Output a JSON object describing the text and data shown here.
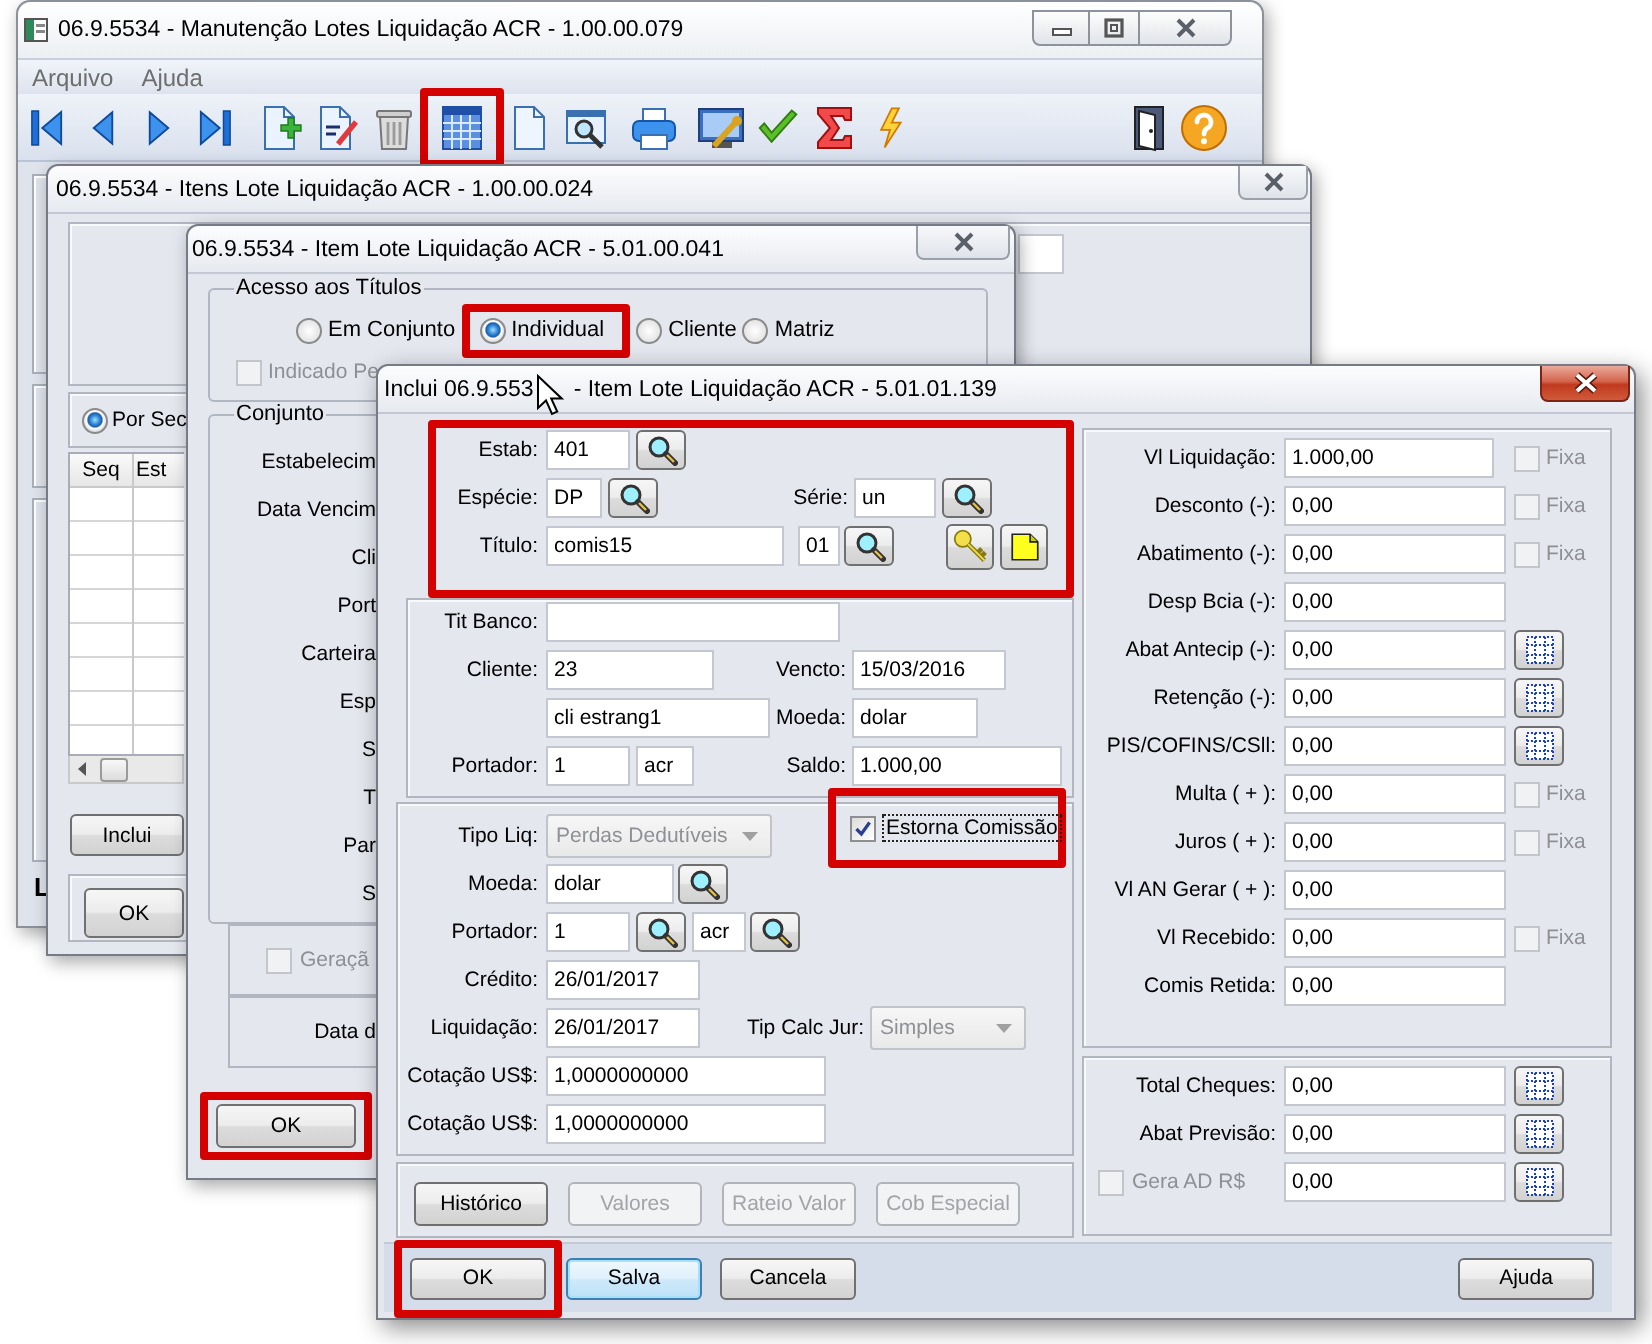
{
  "main_window": {
    "title": "06.9.5534 - Manutenção Lotes Liquidação ACR - 1.00.00.079",
    "menu": [
      {
        "label": "Arquivo",
        "disabled": true
      },
      {
        "label": "Ajuda",
        "disabled": true
      }
    ],
    "toolbar_groups": [
      {
        "items": [
          {
            "kind": "first",
            "highlighted": false
          },
          {
            "kind": "previous",
            "highlighted": false
          },
          {
            "kind": "next",
            "highlighted": false
          },
          {
            "kind": "last",
            "highlighted": false
          }
        ]
      },
      {
        "items": [
          {
            "kind": "new",
            "highlighted": false
          },
          {
            "kind": "edit",
            "highlighted": false
          },
          {
            "kind": "delete",
            "highlighted": false
          }
        ]
      },
      {
        "items": [
          {
            "kind": "calendar",
            "highlighted": true
          }
        ]
      },
      {
        "items": [
          {
            "kind": "document",
            "highlighted": false
          },
          {
            "kind": "preview",
            "highlighted": false
          }
        ]
      },
      {
        "items": [
          {
            "kind": "print",
            "highlighted": false
          }
        ]
      },
      {
        "items": [
          {
            "kind": "setup",
            "highlighted": false
          },
          {
            "kind": "confirm",
            "highlighted": false
          },
          {
            "kind": "sum",
            "highlighted": false
          },
          {
            "kind": "run",
            "highlighted": false
          }
        ]
      },
      {
        "items": [
          {
            "kind": "exit",
            "highlighted": false
          },
          {
            "kind": "help",
            "highlighted": false
          }
        ]
      }
    ],
    "status_text": "L"
  },
  "items_window": {
    "title": "06.9.5534 - Itens Lote Liquidação ACR - 1.00.00.024",
    "order_option": {
      "label": "Por Sec",
      "selected": true
    },
    "grid_columns": [
      "Seq",
      "Est"
    ],
    "add_button": {
      "label": "Inclui"
    },
    "ok_button": {
      "label": "OK"
    }
  },
  "item_window": {
    "title": "06.9.5534 - Item Lote Liquidação ACR - 5.01.00.041",
    "access": {
      "legend": "Acesso aos Títulos",
      "options": [
        {
          "label": "Em Conjunto",
          "selected": false,
          "highlighted": false
        },
        {
          "label": "Individual",
          "selected": true,
          "highlighted": true
        },
        {
          "label": "Cliente",
          "selected": false,
          "highlighted": false
        },
        {
          "label": "Matriz",
          "selected": false,
          "highlighted": false
        }
      ],
      "indicated": {
        "label": "Indicado Pe",
        "checked": false,
        "disabled": true
      }
    },
    "set_group": {
      "legend": "Conjunto",
      "labels": [
        "Estabelecim",
        "Data Vencim",
        "Cli",
        "Port",
        "Carteira",
        "Esp",
        "S",
        "T",
        "Par",
        "S"
      ]
    },
    "generation": {
      "label": "Geraçã",
      "checked": false,
      "disabled": true
    },
    "date_label": "Data d",
    "ok_button": {
      "label": "OK",
      "highlighted": true
    }
  },
  "include_dialog": {
    "title_parts": [
      "Inclui 06.9.553",
      "- Item Lote Liquidação ACR - 5.01.01.139"
    ],
    "key_group": {
      "highlighted": true,
      "estab": {
        "label": "Estab:",
        "value": "401"
      },
      "especie": {
        "label": "Espécie:",
        "value": "DP"
      },
      "serie": {
        "label": "Série:",
        "value": "un"
      },
      "titulo": {
        "label": "Título:",
        "value": "comis15",
        "parcel": "01"
      }
    },
    "bank_group": {
      "tit_banco": {
        "label": "Tit Banco:"
      },
      "cliente": {
        "label": "Cliente:",
        "value": "23",
        "name": "cli estrang1"
      },
      "vencto": {
        "label": "Vencto:",
        "value": "15/03/2016"
      },
      "moeda": {
        "label": "Moeda:",
        "value": "dolar"
      },
      "portador": {
        "label": "Portador:",
        "value": "1",
        "carteira": "acr"
      },
      "saldo": {
        "label": "Saldo:",
        "value": "1.000,00"
      }
    },
    "settlement_group": {
      "tipo_liq": {
        "label": "Tipo Liq:",
        "value": "Perdas Dedutíveis",
        "disabled": true
      },
      "estorna": {
        "label": "Estorna Comissão",
        "checked": true,
        "focused": true,
        "highlighted": true
      },
      "moeda": {
        "label": "Moeda:",
        "value": "dolar"
      },
      "portador": {
        "label": "Portador:",
        "value": "1",
        "carteira": "acr"
      },
      "credito": {
        "label": "Crédito:",
        "value": "26/01/2017"
      },
      "liquidacao": {
        "label": "Liquidação:",
        "value": "26/01/2017"
      },
      "tip_calc_jur": {
        "label": "Tip Calc Jur:",
        "value": "Simples",
        "disabled": true
      },
      "cotacoes": [
        {
          "label": "Cotação US$:",
          "value": "1,0000000000"
        },
        {
          "label": "Cotação US$:",
          "value": "1,0000000000"
        }
      ]
    },
    "action_buttons": [
      {
        "label": "Histórico",
        "disabled": false
      },
      {
        "label": "Valores",
        "disabled": true
      },
      {
        "label": "Rateio Valor",
        "disabled": true
      },
      {
        "label": "Cob Especial",
        "disabled": true
      }
    ],
    "values": [
      {
        "kind": "fixed",
        "label": "Vl Liquidação:",
        "value": "1.000,00",
        "fixed": {
          "label": "Fixa",
          "checked": false,
          "disabled": true
        }
      },
      {
        "kind": "fixed",
        "label": "Desconto (-):",
        "value": "0,00",
        "fixed": {
          "label": "Fixa",
          "checked": false,
          "disabled": true
        }
      },
      {
        "kind": "fixed",
        "label": "Abatimento (-):",
        "value": "0,00",
        "fixed": {
          "label": "Fixa",
          "checked": false,
          "disabled": true
        }
      },
      {
        "kind": "plain",
        "label": "Desp Bcia (-):",
        "value": "0,00"
      },
      {
        "kind": "detail",
        "label": "Abat Antecip (-):",
        "value": "0,00"
      },
      {
        "kind": "detail",
        "label": "Retenção (-):",
        "value": "0,00"
      },
      {
        "kind": "detail",
        "label": "PIS/COFINS/CSll:",
        "value": "0,00"
      },
      {
        "kind": "fixed",
        "label": "Multa ( + ):",
        "value": "0,00",
        "fixed": {
          "label": "Fixa",
          "checked": false,
          "disabled": true
        }
      },
      {
        "kind": "fixed",
        "label": "Juros ( + ):",
        "value": "0,00",
        "fixed": {
          "label": "Fixa",
          "checked": false,
          "disabled": true
        }
      },
      {
        "kind": "plain",
        "label": "Vl AN Gerar ( + ):",
        "value": "0,00"
      },
      {
        "kind": "fixed",
        "label": "Vl Recebido:",
        "value": "0,00",
        "fixed": {
          "label": "Fixa",
          "checked": false,
          "disabled": true
        }
      },
      {
        "kind": "plain",
        "label": "Comis Retida:",
        "value": "0,00"
      }
    ],
    "totals": [
      {
        "kind": "detail",
        "label": "Total Cheques:",
        "value": "0,00"
      },
      {
        "kind": "detail",
        "label": "Abat Previsão:",
        "value": "0,00"
      },
      {
        "kind": "detail",
        "check": {
          "label": "Gera AD R$",
          "checked": false,
          "disabled": true
        },
        "value": "0,00"
      }
    ],
    "bottom_buttons": [
      {
        "label": "OK",
        "highlighted": true,
        "focused": false
      },
      {
        "label": "Salva",
        "highlighted": false,
        "focused": true
      },
      {
        "label": "Cancela",
        "highlighted": false,
        "focused": false
      },
      {
        "label": "Ajuda",
        "highlighted": false,
        "focused": false
      }
    ]
  }
}
